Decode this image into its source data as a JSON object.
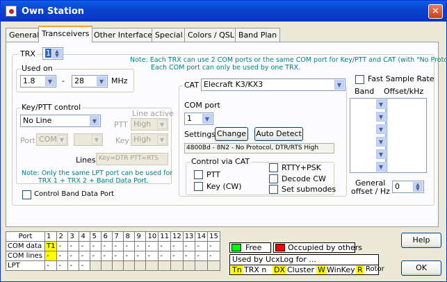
{
  "window": {
    "title": "Own Station",
    "close": "✕"
  },
  "tabs": [
    "General",
    "Transceivers",
    "Other Interfaces",
    "Special",
    "Colors / QSL",
    "Band Plan"
  ],
  "trx": {
    "label": "TRX",
    "value": "1"
  },
  "note_top": "Note: Each TRX can use 2 COM ports or the same COM port for Key/PTT and CAT (with \"No Protocol\").",
  "note_top2": "Each COM port can only be used by one TRX.",
  "fast_sample": "Fast Sample Rate",
  "used_on": {
    "legend": "Used on",
    "from": "1.8",
    "dash": "-",
    "to": "28",
    "unit": "MHz"
  },
  "cat": {
    "label": "CAT",
    "rig": "Elecraft K3/KX3",
    "com_port_label": "COM port",
    "com_port": "1",
    "settings_label": "Settings",
    "change": "Change",
    "auto_detect": "Auto Detect",
    "settings_value": "4800Bd - 8N2 - No Protocol, DTR/RTS High"
  },
  "via_cat": {
    "legend": "Control via CAT",
    "ptt": "PTT",
    "key": "Key (CW)",
    "rtty": "RTTY+PSK",
    "decode": "Decode CW",
    "submodes": "Set submodes"
  },
  "band": {
    "band_hdr": "Band",
    "offset_hdr": "Offset/kHz",
    "general_offset": "General",
    "general_offset2": "offset / Hz",
    "general_value": "0"
  },
  "keyptt": {
    "legend": "Key/PTT control",
    "mode": "No Line",
    "line_active": "Line active",
    "ptt": "PTT",
    "ptt_val": "High",
    "key": "Key",
    "key_val": "High",
    "port_label": "Port",
    "port_val": "COM",
    "lines_label": "Lines",
    "lines_val": "Key=DTR PTT=RTS"
  },
  "note_lpt": "Note:  Only the same LPT port can be used for",
  "note_lpt2": "TRX 1 + TRX 2 + Band Data Port.",
  "control_band": "Control Band Data Port",
  "ports_table": {
    "header": [
      "Port",
      "1",
      "2",
      "3",
      "4",
      "5",
      "6",
      "7",
      "8",
      "9",
      "10",
      "11",
      "12",
      "13",
      "14",
      "15"
    ],
    "rows": [
      {
        "name": "COM data",
        "cells": [
          "T1",
          "-",
          "-",
          "-",
          "-",
          "-",
          "-",
          "-",
          "-",
          "-",
          "-",
          "-",
          "-",
          "-",
          "-"
        ]
      },
      {
        "name": "COM lines",
        "cells": [
          "-",
          "-",
          "-",
          "-",
          "-",
          "-",
          "-",
          "-",
          "-",
          "-",
          "-",
          "-",
          "-",
          "-",
          "-"
        ]
      },
      {
        "name": "LPT",
        "cells": [
          "-",
          "-",
          "-",
          "-",
          "",
          "",
          "",
          "",
          "",
          "",
          "",
          "",
          "",
          "",
          ""
        ]
      }
    ]
  },
  "legend": {
    "free": "Free",
    "occupied": "Occupied by others",
    "used_by": "Used by UcxLog for ...",
    "tn": "Tn",
    "trx_n": "TRX n",
    "dx": "DX",
    "cluster": "Cluster",
    "w": "W",
    "winkey": "WinKey",
    "r": "R",
    "rotor": "Rotor",
    "free_color": "#00ff00",
    "occ_color": "#ff0000",
    "used_color": "#ffff00"
  },
  "buttons": {
    "help": "Help",
    "ok": "OK"
  }
}
